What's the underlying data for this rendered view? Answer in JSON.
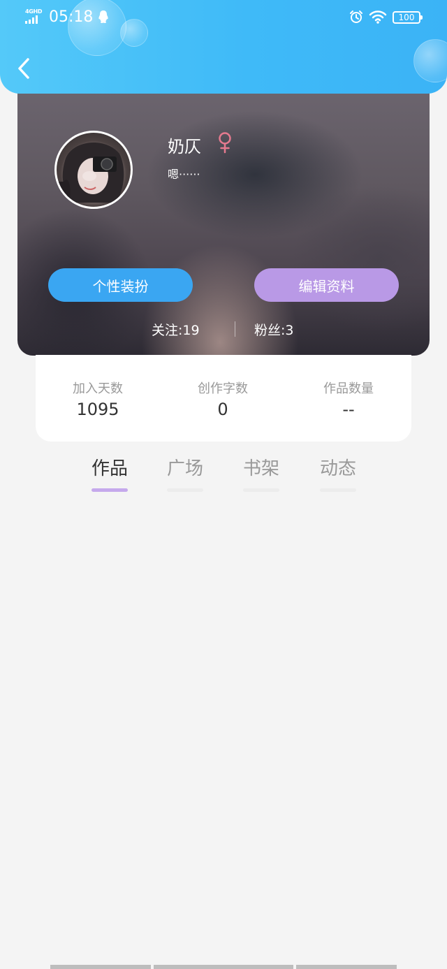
{
  "status_bar": {
    "network": "4GHD",
    "time": "05:18",
    "battery": "100"
  },
  "profile": {
    "name": "奶仄",
    "signature": "嗯······",
    "dress_button": "个性装扮",
    "edit_button": "编辑资料",
    "follow_label": "关注:19",
    "fans_label": "粉丝:3"
  },
  "stats": [
    {
      "label": "加入天数",
      "value": "1095"
    },
    {
      "label": "创作字数",
      "value": "0"
    },
    {
      "label": "作品数量",
      "value": "--"
    }
  ],
  "tabs": [
    {
      "label": "作品",
      "active": true
    },
    {
      "label": "广场",
      "active": false
    },
    {
      "label": "书架",
      "active": false
    },
    {
      "label": "动态",
      "active": false
    }
  ],
  "colors": {
    "header": "#3fbaf8",
    "dress_button": "#3aa6f2",
    "edit_button": "#b999e6",
    "active_tab_underline": "#c5a9ec",
    "gender_icon": "#e67a8f"
  },
  "icons": [
    "signal-icon",
    "qq-icon",
    "alarm-icon",
    "wifi-icon",
    "battery-icon",
    "back-arrow-icon",
    "female-icon"
  ]
}
